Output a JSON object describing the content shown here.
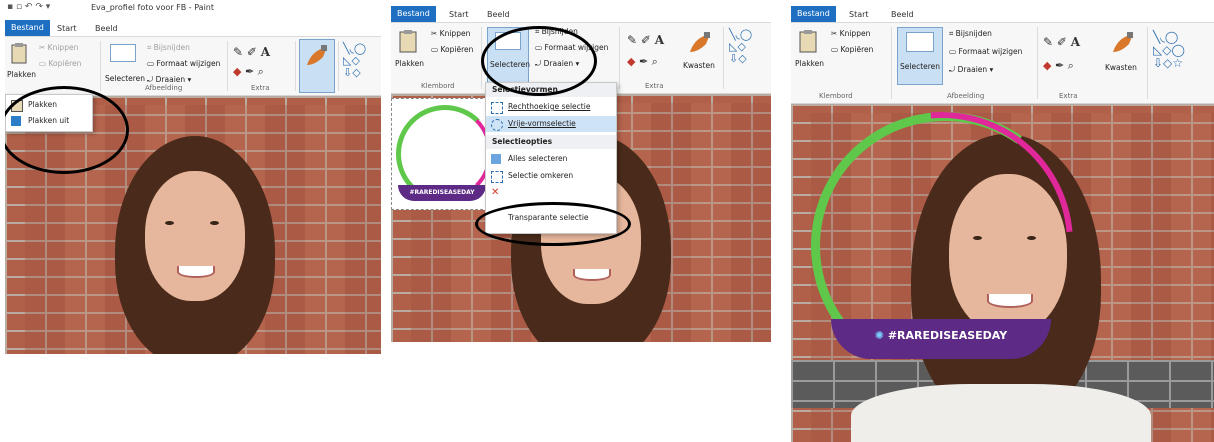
{
  "panel1": {
    "window_title": "Eva_profiel foto voor FB - Paint",
    "tabs": [
      "Bestand",
      "Start",
      "Beeld"
    ],
    "clipboard": {
      "paste": "Plakken",
      "cut": "Knippen",
      "copy": "Kopiëren",
      "group": "Klembord"
    },
    "image": {
      "select": "Selecteren",
      "crop": "Bijsnijden",
      "resize": "Formaat wijzigen",
      "rotate": "Draaien",
      "group": "Afbeelding"
    },
    "tools_group": "Extra",
    "paste_menu": [
      "Plakken",
      "Plakken uit"
    ]
  },
  "panel2": {
    "tabs": [
      "Bestand",
      "Start",
      "Beeld"
    ],
    "clipboard": {
      "paste": "Plakken",
      "cut": "Knippen",
      "copy": "Kopiëren",
      "group": "Klembord"
    },
    "image": {
      "select": "Selecteren",
      "crop": "Bijsnijden",
      "resize": "Formaat wijzigen",
      "rotate": "Draaien"
    },
    "tools_group": "Extra",
    "brushes": "Kwasten",
    "select_menu": {
      "head1": "Selectievormen",
      "items1": [
        "Rechthoekige selectie",
        "Vrije-vormselectie"
      ],
      "head2": "Selectieopties",
      "items2": [
        "Alles selecteren",
        "Selectie omkeren",
        "",
        "Transparante selectie"
      ]
    },
    "frame_banner": "#RAREDISEASEDAY"
  },
  "panel3": {
    "tabs": [
      "Bestand",
      "Start",
      "Beeld"
    ],
    "clipboard": {
      "paste": "Plakken",
      "cut": "Knippen",
      "copy": "Kopiëren",
      "group": "Klembord"
    },
    "image": {
      "select": "Selecteren",
      "crop": "Bijsnijden",
      "resize": "Formaat wijzigen",
      "rotate": "Draaien",
      "group": "Afbeelding"
    },
    "tools_group": "Extra",
    "brushes": "Kwasten",
    "frame_banner": "#RAREDISEASEDAY"
  },
  "colors": {
    "file_tab": "#1e6fc1",
    "frame_purple": "#5d2a86",
    "frame_green": "#5fc84a",
    "frame_pink": "#e0289b",
    "brick": "#b05f48"
  }
}
